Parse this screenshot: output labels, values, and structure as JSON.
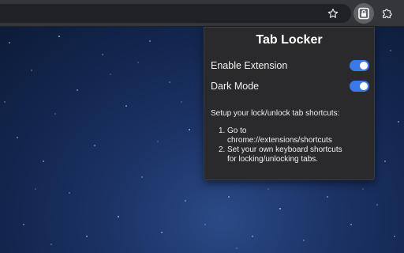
{
  "browser": {
    "toolbar_icons": [
      "star-icon",
      "tab-locker-extension-icon",
      "puzzle-icon"
    ]
  },
  "popup": {
    "title": "Tab Locker",
    "settings": [
      {
        "label": "Enable Extension",
        "enabled": true
      },
      {
        "label": "Dark Mode",
        "enabled": true
      }
    ],
    "shortcut_heading": "Setup your lock/unlock tab shortcuts:",
    "steps": [
      {
        "number": "1.",
        "lines": [
          "Go to",
          "chrome://extensions/shortcuts"
        ]
      },
      {
        "number": "2.",
        "lines": [
          "Set your own keyboard shortcuts",
          "for locking/unlocking tabs."
        ]
      }
    ]
  },
  "colors": {
    "toolbar_bg": "#35363a",
    "popup_bg": "#2a2a2c",
    "toggle_on": "#3b78e7"
  }
}
